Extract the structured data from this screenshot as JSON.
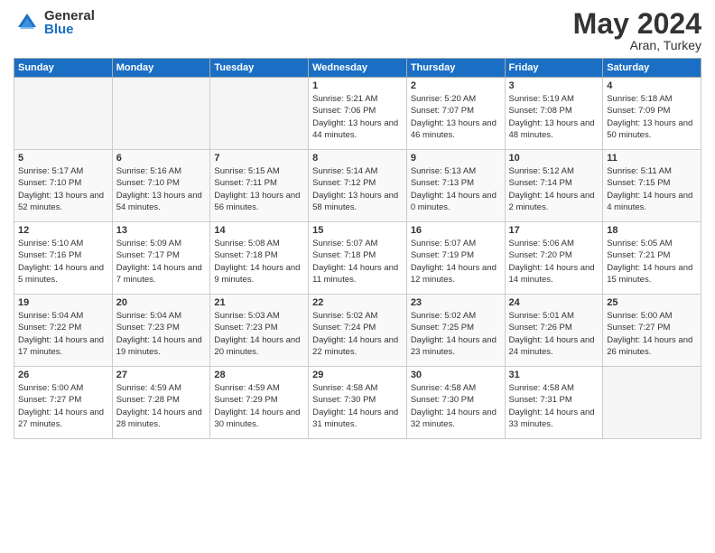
{
  "logo": {
    "general": "General",
    "blue": "Blue"
  },
  "title": "May 2024",
  "location": "Aran, Turkey",
  "days_header": [
    "Sunday",
    "Monday",
    "Tuesday",
    "Wednesday",
    "Thursday",
    "Friday",
    "Saturday"
  ],
  "weeks": [
    [
      {
        "num": "",
        "sunrise": "",
        "sunset": "",
        "daylight": "",
        "empty": true
      },
      {
        "num": "",
        "sunrise": "",
        "sunset": "",
        "daylight": "",
        "empty": true
      },
      {
        "num": "",
        "sunrise": "",
        "sunset": "",
        "daylight": "",
        "empty": true
      },
      {
        "num": "1",
        "sunrise": "Sunrise: 5:21 AM",
        "sunset": "Sunset: 7:06 PM",
        "daylight": "Daylight: 13 hours and 44 minutes."
      },
      {
        "num": "2",
        "sunrise": "Sunrise: 5:20 AM",
        "sunset": "Sunset: 7:07 PM",
        "daylight": "Daylight: 13 hours and 46 minutes."
      },
      {
        "num": "3",
        "sunrise": "Sunrise: 5:19 AM",
        "sunset": "Sunset: 7:08 PM",
        "daylight": "Daylight: 13 hours and 48 minutes."
      },
      {
        "num": "4",
        "sunrise": "Sunrise: 5:18 AM",
        "sunset": "Sunset: 7:09 PM",
        "daylight": "Daylight: 13 hours and 50 minutes."
      }
    ],
    [
      {
        "num": "5",
        "sunrise": "Sunrise: 5:17 AM",
        "sunset": "Sunset: 7:10 PM",
        "daylight": "Daylight: 13 hours and 52 minutes."
      },
      {
        "num": "6",
        "sunrise": "Sunrise: 5:16 AM",
        "sunset": "Sunset: 7:10 PM",
        "daylight": "Daylight: 13 hours and 54 minutes."
      },
      {
        "num": "7",
        "sunrise": "Sunrise: 5:15 AM",
        "sunset": "Sunset: 7:11 PM",
        "daylight": "Daylight: 13 hours and 56 minutes."
      },
      {
        "num": "8",
        "sunrise": "Sunrise: 5:14 AM",
        "sunset": "Sunset: 7:12 PM",
        "daylight": "Daylight: 13 hours and 58 minutes."
      },
      {
        "num": "9",
        "sunrise": "Sunrise: 5:13 AM",
        "sunset": "Sunset: 7:13 PM",
        "daylight": "Daylight: 14 hours and 0 minutes."
      },
      {
        "num": "10",
        "sunrise": "Sunrise: 5:12 AM",
        "sunset": "Sunset: 7:14 PM",
        "daylight": "Daylight: 14 hours and 2 minutes."
      },
      {
        "num": "11",
        "sunrise": "Sunrise: 5:11 AM",
        "sunset": "Sunset: 7:15 PM",
        "daylight": "Daylight: 14 hours and 4 minutes."
      }
    ],
    [
      {
        "num": "12",
        "sunrise": "Sunrise: 5:10 AM",
        "sunset": "Sunset: 7:16 PM",
        "daylight": "Daylight: 14 hours and 5 minutes."
      },
      {
        "num": "13",
        "sunrise": "Sunrise: 5:09 AM",
        "sunset": "Sunset: 7:17 PM",
        "daylight": "Daylight: 14 hours and 7 minutes."
      },
      {
        "num": "14",
        "sunrise": "Sunrise: 5:08 AM",
        "sunset": "Sunset: 7:18 PM",
        "daylight": "Daylight: 14 hours and 9 minutes."
      },
      {
        "num": "15",
        "sunrise": "Sunrise: 5:07 AM",
        "sunset": "Sunset: 7:18 PM",
        "daylight": "Daylight: 14 hours and 11 minutes."
      },
      {
        "num": "16",
        "sunrise": "Sunrise: 5:07 AM",
        "sunset": "Sunset: 7:19 PM",
        "daylight": "Daylight: 14 hours and 12 minutes."
      },
      {
        "num": "17",
        "sunrise": "Sunrise: 5:06 AM",
        "sunset": "Sunset: 7:20 PM",
        "daylight": "Daylight: 14 hours and 14 minutes."
      },
      {
        "num": "18",
        "sunrise": "Sunrise: 5:05 AM",
        "sunset": "Sunset: 7:21 PM",
        "daylight": "Daylight: 14 hours and 15 minutes."
      }
    ],
    [
      {
        "num": "19",
        "sunrise": "Sunrise: 5:04 AM",
        "sunset": "Sunset: 7:22 PM",
        "daylight": "Daylight: 14 hours and 17 minutes."
      },
      {
        "num": "20",
        "sunrise": "Sunrise: 5:04 AM",
        "sunset": "Sunset: 7:23 PM",
        "daylight": "Daylight: 14 hours and 19 minutes."
      },
      {
        "num": "21",
        "sunrise": "Sunrise: 5:03 AM",
        "sunset": "Sunset: 7:23 PM",
        "daylight": "Daylight: 14 hours and 20 minutes."
      },
      {
        "num": "22",
        "sunrise": "Sunrise: 5:02 AM",
        "sunset": "Sunset: 7:24 PM",
        "daylight": "Daylight: 14 hours and 22 minutes."
      },
      {
        "num": "23",
        "sunrise": "Sunrise: 5:02 AM",
        "sunset": "Sunset: 7:25 PM",
        "daylight": "Daylight: 14 hours and 23 minutes."
      },
      {
        "num": "24",
        "sunrise": "Sunrise: 5:01 AM",
        "sunset": "Sunset: 7:26 PM",
        "daylight": "Daylight: 14 hours and 24 minutes."
      },
      {
        "num": "25",
        "sunrise": "Sunrise: 5:00 AM",
        "sunset": "Sunset: 7:27 PM",
        "daylight": "Daylight: 14 hours and 26 minutes."
      }
    ],
    [
      {
        "num": "26",
        "sunrise": "Sunrise: 5:00 AM",
        "sunset": "Sunset: 7:27 PM",
        "daylight": "Daylight: 14 hours and 27 minutes."
      },
      {
        "num": "27",
        "sunrise": "Sunrise: 4:59 AM",
        "sunset": "Sunset: 7:28 PM",
        "daylight": "Daylight: 14 hours and 28 minutes."
      },
      {
        "num": "28",
        "sunrise": "Sunrise: 4:59 AM",
        "sunset": "Sunset: 7:29 PM",
        "daylight": "Daylight: 14 hours and 30 minutes."
      },
      {
        "num": "29",
        "sunrise": "Sunrise: 4:58 AM",
        "sunset": "Sunset: 7:30 PM",
        "daylight": "Daylight: 14 hours and 31 minutes."
      },
      {
        "num": "30",
        "sunrise": "Sunrise: 4:58 AM",
        "sunset": "Sunset: 7:30 PM",
        "daylight": "Daylight: 14 hours and 32 minutes."
      },
      {
        "num": "31",
        "sunrise": "Sunrise: 4:58 AM",
        "sunset": "Sunset: 7:31 PM",
        "daylight": "Daylight: 14 hours and 33 minutes."
      },
      {
        "num": "",
        "sunrise": "",
        "sunset": "",
        "daylight": "",
        "empty": true
      }
    ]
  ]
}
